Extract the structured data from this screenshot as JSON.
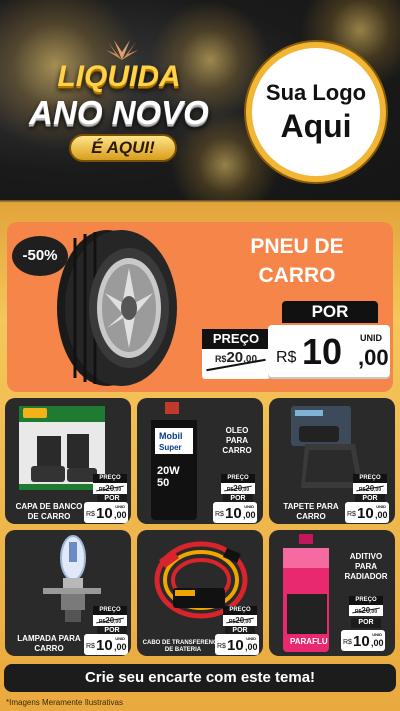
{
  "header": {
    "brand_line1": "LIQUIDA",
    "brand_line2": "ANO NOVO",
    "brand_pill": "É AQUI!",
    "logo_line1": "Sua Logo",
    "logo_line2": "Aqui"
  },
  "featured": {
    "discount": "-50%",
    "title_line1": "PNEU DE",
    "title_line2": "CARRO",
    "por_label": "POR",
    "preco_label": "PREÇO",
    "old_currency": "R$",
    "old_int": "20",
    "old_cents": ",00",
    "new_currency": "R$",
    "new_int": "10",
    "new_cents": ",00",
    "unid": "UNID"
  },
  "products": [
    {
      "name_line1": "CAPA DE BANCO",
      "name_line2": "DE CARRO",
      "preco": "PREÇO",
      "old_rs": "R$",
      "old_int": "20",
      "old_cents": ",00",
      "por": "POR",
      "new_rs": "R$",
      "new_int": "10",
      "new_cents": ",00",
      "unid": "UNID",
      "icon": "seat-cover-icon"
    },
    {
      "name_line1": "OLEO",
      "name_line2": "PARA",
      "name_line3": "CARRO",
      "preco": "PREÇO",
      "old_rs": "R$",
      "old_int": "20",
      "old_cents": ",00",
      "por": "POR",
      "new_rs": "R$",
      "new_int": "10",
      "new_cents": ",00",
      "unid": "UNID",
      "icon": "oil-bottle-icon",
      "oil_brand1": "Mobil",
      "oil_brand2": "Super",
      "oil_grade1": "20W",
      "oil_grade2": "50"
    },
    {
      "name_line1": "TAPETE PARA",
      "name_line2": "CARRO",
      "preco": "PREÇO",
      "old_rs": "R$",
      "old_int": "20",
      "old_cents": ",00",
      "por": "POR",
      "new_rs": "R$",
      "new_int": "10",
      "new_cents": ",00",
      "unid": "UNID",
      "icon": "car-mat-icon"
    },
    {
      "name_line1": "LAMPADA PARA",
      "name_line2": "CARRO",
      "preco": "PREÇO",
      "old_rs": "R$",
      "old_int": "20",
      "old_cents": ",00",
      "por": "POR",
      "new_rs": "R$",
      "new_int": "10",
      "new_cents": ",00",
      "unid": "UNID",
      "icon": "headlight-bulb-icon"
    },
    {
      "name_line1": "CABO DE TRANSFERENCIA",
      "name_line2": "DE BATERIA",
      "preco": "PREÇO",
      "old_rs": "R$",
      "old_int": "20",
      "old_cents": ",00",
      "por": "POR",
      "new_rs": "R$",
      "new_int": "10",
      "new_cents": ",00",
      "unid": "UNID",
      "icon": "jumper-cable-icon"
    },
    {
      "name_line1": "ADITIVO",
      "name_line2": "PARA",
      "name_line3": "RADIADOR",
      "preco": "PREÇO",
      "old_rs": "R$",
      "old_int": "20",
      "old_cents": ",00",
      "por": "POR",
      "new_rs": "R$",
      "new_int": "10",
      "new_cents": ",00",
      "unid": "UNID",
      "icon": "coolant-bottle-icon",
      "coolant_label": "PARAFLU"
    }
  ],
  "cta": "Crie seu encarte com este tema!",
  "footnote": "*Imagens Meramente Ilustrativas",
  "colors": {
    "accent_orange": "#f6854a",
    "gold": "#f4c65b",
    "dark": "#1c1c1c"
  }
}
